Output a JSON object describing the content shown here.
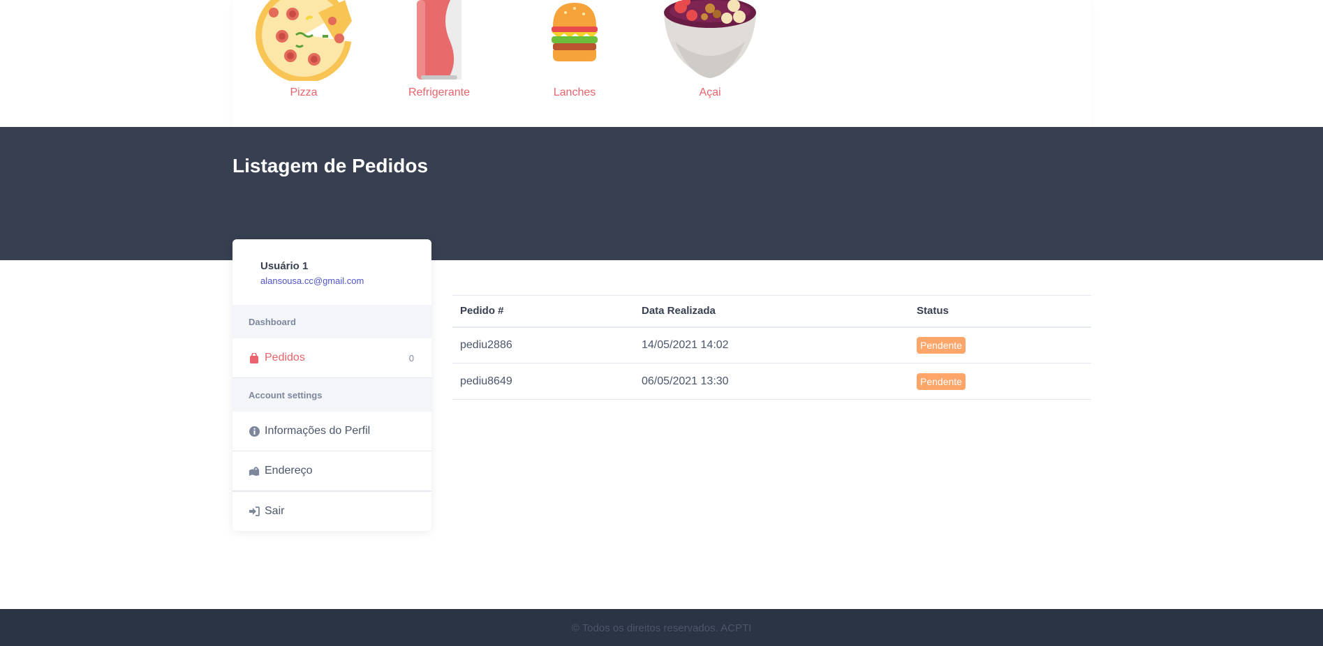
{
  "categories": [
    {
      "label": "Pizza",
      "icon": "pizza-icon"
    },
    {
      "label": "Refrigerante",
      "icon": "soda-can-icon"
    },
    {
      "label": "Lanches",
      "icon": "burger-icon"
    },
    {
      "label": "Açai",
      "icon": "acai-bowl-icon"
    }
  ],
  "header": {
    "title": "Listagem de Pedidos"
  },
  "sidebar": {
    "user_name": "Usuário 1",
    "user_email": "alansousa.cc@gmail.com",
    "section_dashboard": "Dashboard",
    "pedidos_label": "Pedidos",
    "pedidos_count": "0",
    "section_account": "Account settings",
    "perfil_label": "Informações do Perfil",
    "endereco_label": "Endereço",
    "sair_label": "Sair"
  },
  "table": {
    "headers": [
      "Pedido #",
      "Data Realizada",
      "Status"
    ],
    "rows": [
      {
        "pedido": "pediu2886",
        "data": "14/05/2021 14:02",
        "status": "Pendente"
      },
      {
        "pedido": "pediu8649",
        "data": "06/05/2021 13:30",
        "status": "Pendente"
      }
    ]
  },
  "footer": {
    "text": "© Todos os direitos reservados. ACPTI"
  },
  "colors": {
    "accent": "#e8636b",
    "dark_band": "#373f50",
    "badge": "#fea569",
    "footer": "#2b3445"
  }
}
